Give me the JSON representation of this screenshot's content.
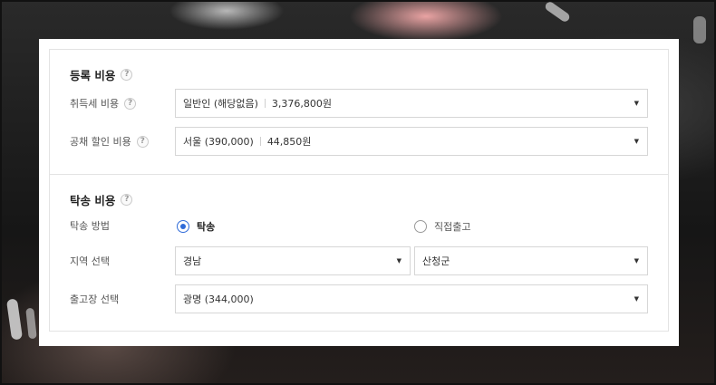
{
  "registration": {
    "title": "등록 비용",
    "help_icon": "?",
    "acquisition_tax": {
      "label": "취득세 비용",
      "selected_option": "일반인 (해당없음)",
      "amount": "3,376,800원"
    },
    "bond_discount": {
      "label": "공채 할인 비용",
      "selected_option": "서울 (390,000)",
      "amount": "44,850원"
    }
  },
  "delivery": {
    "title": "탁송 비용",
    "help_icon": "?",
    "method": {
      "label": "탁송 방법",
      "options": [
        {
          "label": "탁송",
          "selected": true
        },
        {
          "label": "직접출고",
          "selected": false
        }
      ]
    },
    "region": {
      "label": "지역 선택",
      "province": "경남",
      "district": "산청군"
    },
    "release_center": {
      "label": "출고장 선택",
      "selected_option": "광명 (344,000)"
    }
  },
  "caret_icon": "▼",
  "colors": {
    "accent": "#2f6bd9",
    "border": "#d6d6d6",
    "divider": "#e3e3e3"
  }
}
